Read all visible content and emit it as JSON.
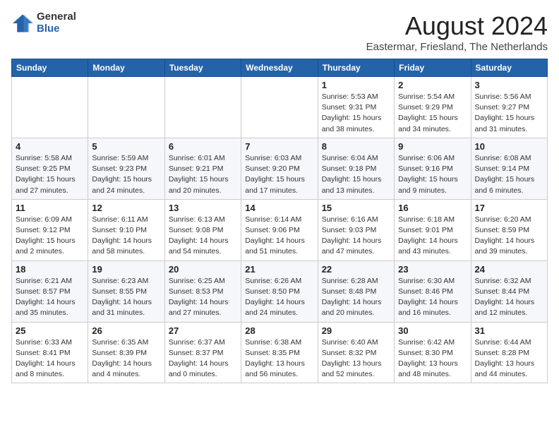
{
  "logo": {
    "general": "General",
    "blue": "Blue"
  },
  "title": {
    "month_year": "August 2024",
    "location": "Eastermar, Friesland, The Netherlands"
  },
  "headers": [
    "Sunday",
    "Monday",
    "Tuesday",
    "Wednesday",
    "Thursday",
    "Friday",
    "Saturday"
  ],
  "weeks": [
    [
      {
        "day": "",
        "detail": ""
      },
      {
        "day": "",
        "detail": ""
      },
      {
        "day": "",
        "detail": ""
      },
      {
        "day": "",
        "detail": ""
      },
      {
        "day": "1",
        "detail": "Sunrise: 5:53 AM\nSunset: 9:31 PM\nDaylight: 15 hours\nand 38 minutes."
      },
      {
        "day": "2",
        "detail": "Sunrise: 5:54 AM\nSunset: 9:29 PM\nDaylight: 15 hours\nand 34 minutes."
      },
      {
        "day": "3",
        "detail": "Sunrise: 5:56 AM\nSunset: 9:27 PM\nDaylight: 15 hours\nand 31 minutes."
      }
    ],
    [
      {
        "day": "4",
        "detail": "Sunrise: 5:58 AM\nSunset: 9:25 PM\nDaylight: 15 hours\nand 27 minutes."
      },
      {
        "day": "5",
        "detail": "Sunrise: 5:59 AM\nSunset: 9:23 PM\nDaylight: 15 hours\nand 24 minutes."
      },
      {
        "day": "6",
        "detail": "Sunrise: 6:01 AM\nSunset: 9:21 PM\nDaylight: 15 hours\nand 20 minutes."
      },
      {
        "day": "7",
        "detail": "Sunrise: 6:03 AM\nSunset: 9:20 PM\nDaylight: 15 hours\nand 17 minutes."
      },
      {
        "day": "8",
        "detail": "Sunrise: 6:04 AM\nSunset: 9:18 PM\nDaylight: 15 hours\nand 13 minutes."
      },
      {
        "day": "9",
        "detail": "Sunrise: 6:06 AM\nSunset: 9:16 PM\nDaylight: 15 hours\nand 9 minutes."
      },
      {
        "day": "10",
        "detail": "Sunrise: 6:08 AM\nSunset: 9:14 PM\nDaylight: 15 hours\nand 6 minutes."
      }
    ],
    [
      {
        "day": "11",
        "detail": "Sunrise: 6:09 AM\nSunset: 9:12 PM\nDaylight: 15 hours\nand 2 minutes."
      },
      {
        "day": "12",
        "detail": "Sunrise: 6:11 AM\nSunset: 9:10 PM\nDaylight: 14 hours\nand 58 minutes."
      },
      {
        "day": "13",
        "detail": "Sunrise: 6:13 AM\nSunset: 9:08 PM\nDaylight: 14 hours\nand 54 minutes."
      },
      {
        "day": "14",
        "detail": "Sunrise: 6:14 AM\nSunset: 9:06 PM\nDaylight: 14 hours\nand 51 minutes."
      },
      {
        "day": "15",
        "detail": "Sunrise: 6:16 AM\nSunset: 9:03 PM\nDaylight: 14 hours\nand 47 minutes."
      },
      {
        "day": "16",
        "detail": "Sunrise: 6:18 AM\nSunset: 9:01 PM\nDaylight: 14 hours\nand 43 minutes."
      },
      {
        "day": "17",
        "detail": "Sunrise: 6:20 AM\nSunset: 8:59 PM\nDaylight: 14 hours\nand 39 minutes."
      }
    ],
    [
      {
        "day": "18",
        "detail": "Sunrise: 6:21 AM\nSunset: 8:57 PM\nDaylight: 14 hours\nand 35 minutes."
      },
      {
        "day": "19",
        "detail": "Sunrise: 6:23 AM\nSunset: 8:55 PM\nDaylight: 14 hours\nand 31 minutes."
      },
      {
        "day": "20",
        "detail": "Sunrise: 6:25 AM\nSunset: 8:53 PM\nDaylight: 14 hours\nand 27 minutes."
      },
      {
        "day": "21",
        "detail": "Sunrise: 6:26 AM\nSunset: 8:50 PM\nDaylight: 14 hours\nand 24 minutes."
      },
      {
        "day": "22",
        "detail": "Sunrise: 6:28 AM\nSunset: 8:48 PM\nDaylight: 14 hours\nand 20 minutes."
      },
      {
        "day": "23",
        "detail": "Sunrise: 6:30 AM\nSunset: 8:46 PM\nDaylight: 14 hours\nand 16 minutes."
      },
      {
        "day": "24",
        "detail": "Sunrise: 6:32 AM\nSunset: 8:44 PM\nDaylight: 14 hours\nand 12 minutes."
      }
    ],
    [
      {
        "day": "25",
        "detail": "Sunrise: 6:33 AM\nSunset: 8:41 PM\nDaylight: 14 hours\nand 8 minutes."
      },
      {
        "day": "26",
        "detail": "Sunrise: 6:35 AM\nSunset: 8:39 PM\nDaylight: 14 hours\nand 4 minutes."
      },
      {
        "day": "27",
        "detail": "Sunrise: 6:37 AM\nSunset: 8:37 PM\nDaylight: 14 hours\nand 0 minutes."
      },
      {
        "day": "28",
        "detail": "Sunrise: 6:38 AM\nSunset: 8:35 PM\nDaylight: 13 hours\nand 56 minutes."
      },
      {
        "day": "29",
        "detail": "Sunrise: 6:40 AM\nSunset: 8:32 PM\nDaylight: 13 hours\nand 52 minutes."
      },
      {
        "day": "30",
        "detail": "Sunrise: 6:42 AM\nSunset: 8:30 PM\nDaylight: 13 hours\nand 48 minutes."
      },
      {
        "day": "31",
        "detail": "Sunrise: 6:44 AM\nSunset: 8:28 PM\nDaylight: 13 hours\nand 44 minutes."
      }
    ]
  ]
}
